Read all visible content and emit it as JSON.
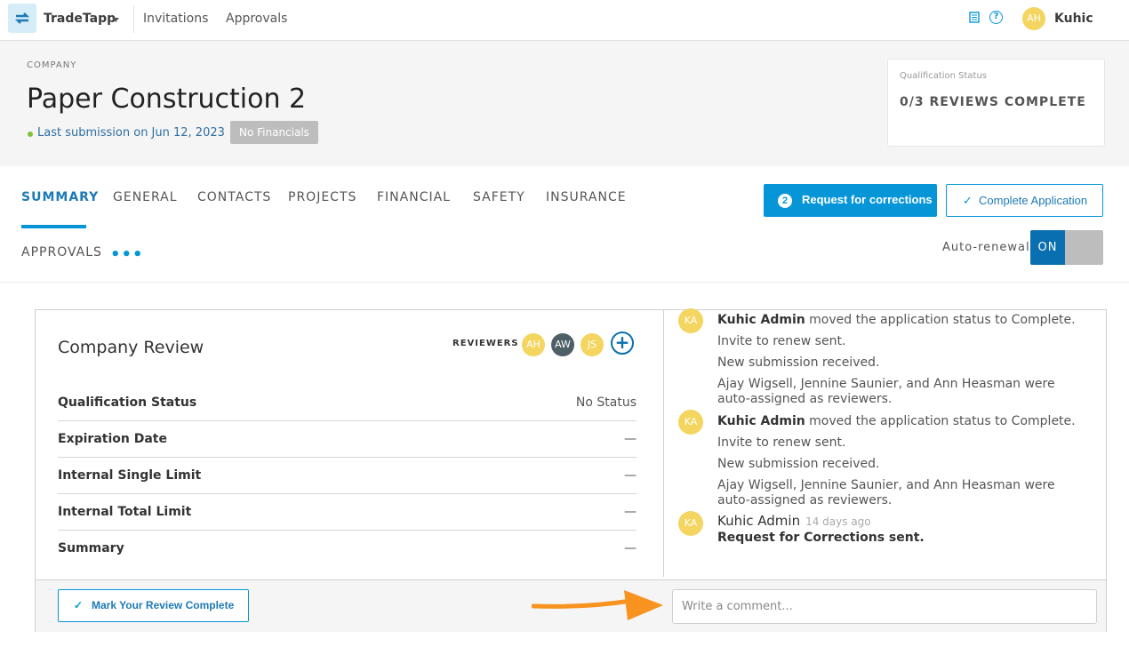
{
  "nav": {
    "app_name": "TradeTapp",
    "links": [
      "Invitations",
      "Approvals"
    ],
    "user_initials": "AH",
    "user_name": "Kuhic",
    "help_glyph": "?"
  },
  "company": {
    "label": "COMPANY",
    "name": "Paper Construction 2",
    "last_submission": "Last submission on Jun 12, 2023",
    "financials_badge": "No Financials"
  },
  "qualification_card": {
    "label": "Qualification Status",
    "value": "0/3 REVIEWS COMPLETE"
  },
  "tabs": [
    "SUMMARY",
    "GENERAL",
    "CONTACTS",
    "PROJECTS",
    "FINANCIAL",
    "SAFETY",
    "INSURANCE",
    "APPROVALS"
  ],
  "active_tab": "SUMMARY",
  "more_glyph": "•••",
  "actions": {
    "request_count": "2",
    "request_label": "Request for corrections",
    "complete_label": "Complete Application",
    "check_glyph": "✓",
    "auto_renewal_label": "Auto-renewal",
    "toggle_state": "ON"
  },
  "review": {
    "title": "Company Review",
    "reviewers_label": "REVIEWERS",
    "reviewers": [
      "AH",
      "AW",
      "JS"
    ],
    "add_glyph": "+",
    "fields": [
      {
        "label": "Qualification Status",
        "value": "No Status"
      },
      {
        "label": "Expiration Date",
        "value": "—"
      },
      {
        "label": "Internal Single Limit",
        "value": "—"
      },
      {
        "label": "Internal Total Limit",
        "value": "—"
      },
      {
        "label": "Summary",
        "value": "—"
      }
    ],
    "mark_complete_label": "Mark Your Review Complete"
  },
  "activity": {
    "avatar_initials": "KA",
    "entries": [
      {
        "actor": "Kuhic Admin",
        "text": " moved the application status to Complete."
      },
      {
        "text": "Invite to renew sent."
      },
      {
        "text": "New submission received."
      },
      {
        "text": "Ajay Wigsell, Jennine Saunier, and Ann Heasman were auto-assigned as reviewers."
      },
      {
        "actor": "Kuhic Admin",
        "text": " moved the application status to Complete."
      },
      {
        "text": "Invite to renew sent."
      },
      {
        "text": "New submission received."
      },
      {
        "text": "Ajay Wigsell, Jennine Saunier, and Ann Heasman were auto-assigned as reviewers."
      },
      {
        "actor": "Kuhic Admin",
        "time": "14 days ago",
        "bold_text": "Request for Corrections sent."
      }
    ]
  },
  "comment": {
    "placeholder": "Write a comment..."
  },
  "colors": {
    "accent": "#0696d7",
    "toggle_on": "#0a6fb0",
    "avatar_yellow": "#f3d560",
    "annotation_arrow": "#f7931e"
  }
}
